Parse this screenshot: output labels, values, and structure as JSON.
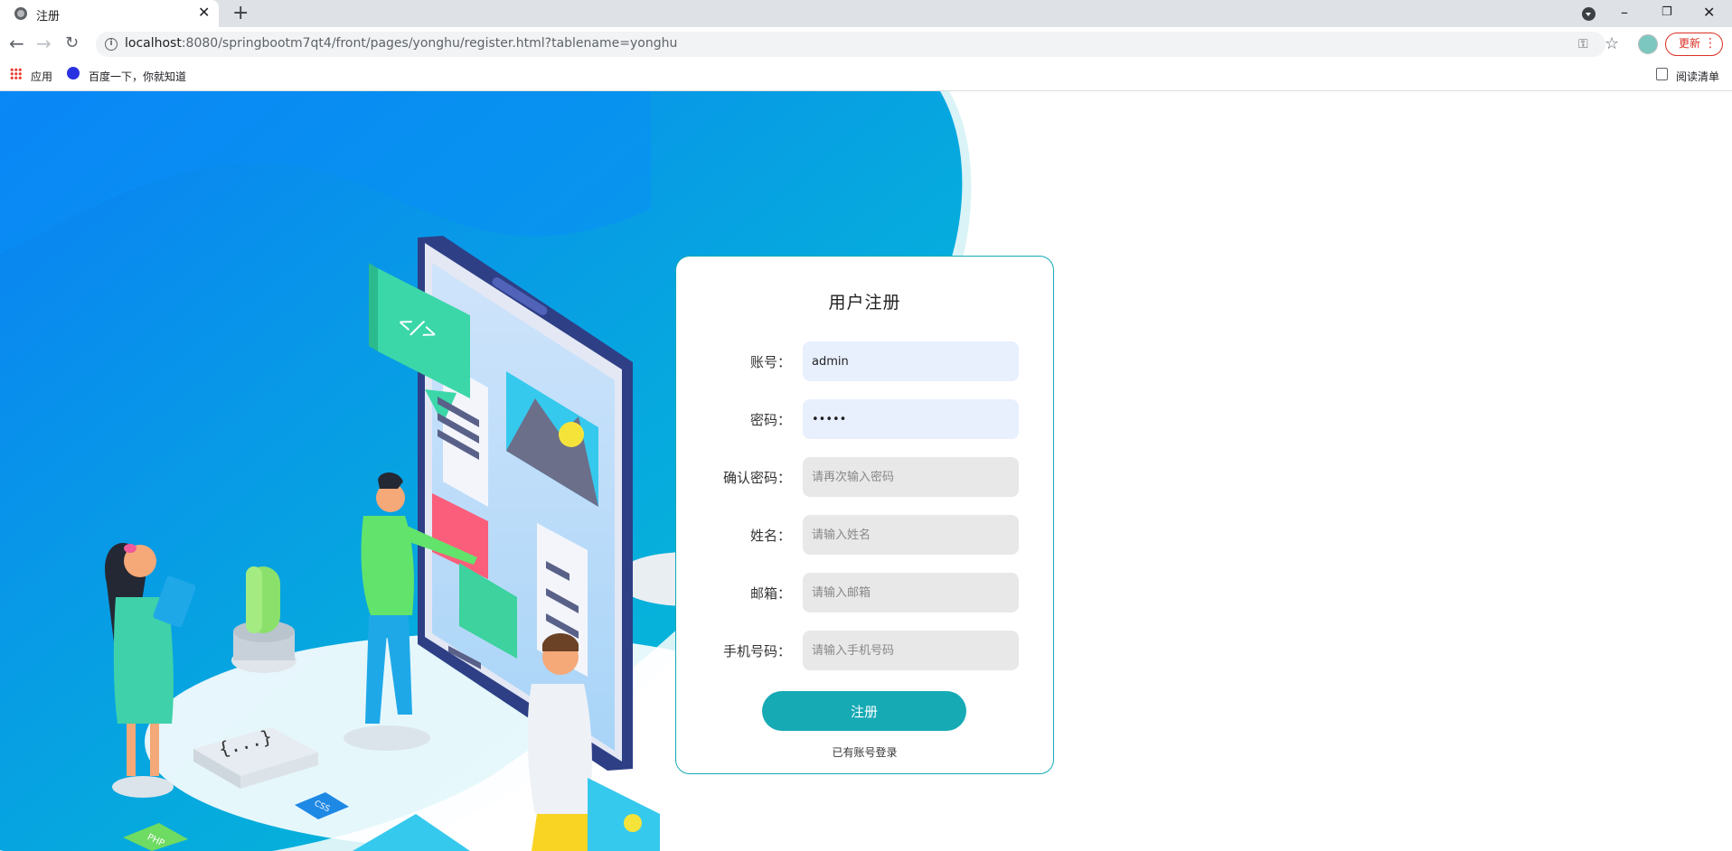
{
  "browser": {
    "tab_title": "注册",
    "url_host": "localhost",
    "url_rest": ":8080/springbootm7qt4/front/pages/yonghu/register.html?tablename=yonghu",
    "update_label": "更新",
    "bookmarks": [
      "应用",
      "百度一下，你就知道"
    ],
    "reading_list": "阅读清单",
    "icons": [
      "back-icon",
      "forward-icon",
      "reload-icon",
      "info-icon",
      "key-icon",
      "star-icon",
      "apps-icon",
      "baidu-icon",
      "reading-list-icon"
    ]
  },
  "form": {
    "title": "用户注册",
    "fields": [
      {
        "label": "账号：",
        "value": "admin",
        "placeholder": ""
      },
      {
        "label": "密码：",
        "value": "•••••",
        "placeholder": ""
      },
      {
        "label": "确认密码：",
        "value": "",
        "placeholder": "请再次输入密码"
      },
      {
        "label": "姓名：",
        "value": "",
        "placeholder": "请输入姓名"
      },
      {
        "label": "邮箱：",
        "value": "",
        "placeholder": "请输入邮箱"
      },
      {
        "label": "手机号码：",
        "value": "",
        "placeholder": "请输入手机号码"
      }
    ],
    "submit_label": "注册",
    "login_link": "已有账号登录"
  },
  "illustration": {
    "tags": [
      "CSS",
      "PHP"
    ],
    "code_bubble": "</>"
  },
  "colors": {
    "accent": "#16aab5",
    "bg_gradient_start": "#0a7ff5",
    "bg_gradient_end": "#08c2d4"
  }
}
